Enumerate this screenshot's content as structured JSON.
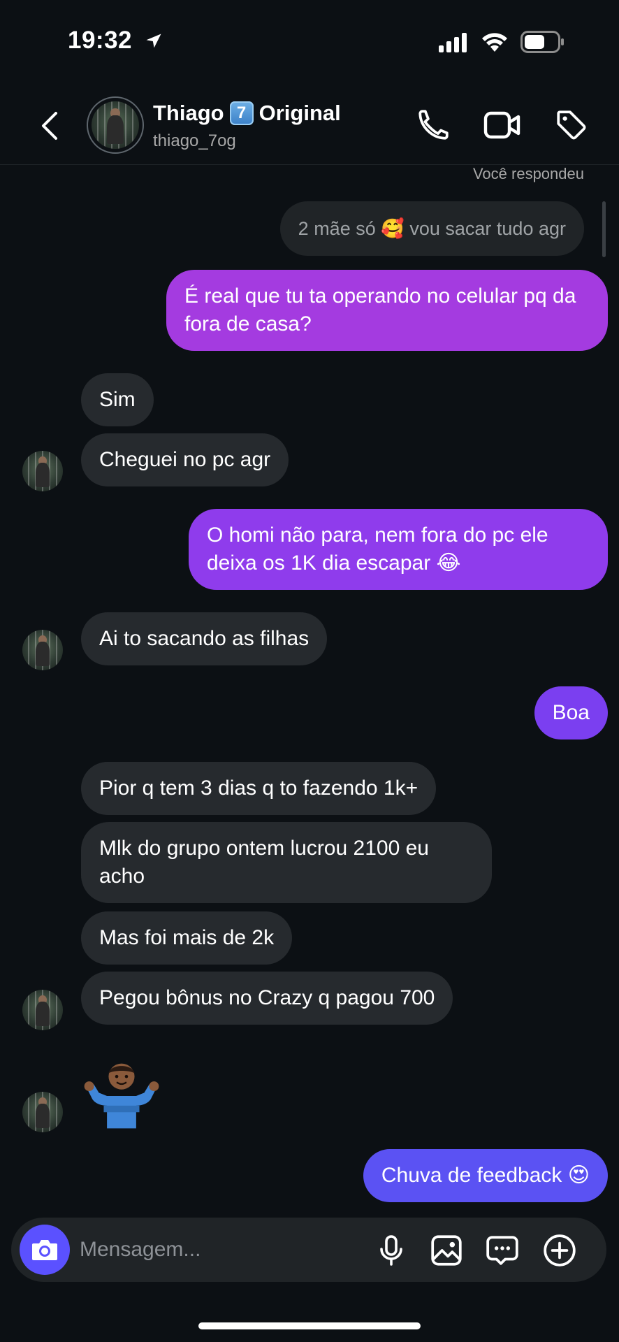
{
  "status_bar": {
    "time": "19:32"
  },
  "header": {
    "name": "Thiago",
    "badge": "7",
    "name_suffix": "Original",
    "username": "thiago_7og"
  },
  "reply": {
    "label": "Você respondeu",
    "quote": "2 mãe só 🥰 vou sacar tudo agr"
  },
  "messages": [
    {
      "side": "out",
      "text": "É real que tu ta operando no celular pq da fora de casa?"
    },
    {
      "side": "in",
      "text": "Sim"
    },
    {
      "side": "in",
      "text": "Cheguei no pc agr"
    },
    {
      "side": "out",
      "text": "O homi não para, nem fora do pc ele deixa os 1K dia escapar 😂"
    },
    {
      "side": "in",
      "text": "Ai to sacando as filhas"
    },
    {
      "side": "out",
      "text": "Boa"
    },
    {
      "side": "in",
      "text": "Pior q tem 3 dias q to fazendo 1k+"
    },
    {
      "side": "in",
      "text": "Mlk do grupo ontem lucrou 2100 eu acho"
    },
    {
      "side": "in",
      "text": "Mas foi mais de 2k"
    },
    {
      "side": "in",
      "text": "Pegou bônus no Crazy q pagou 700"
    },
    {
      "side": "in",
      "text": "🤷🏾‍♂️"
    },
    {
      "side": "out",
      "text": "Chuva de feedback 😍"
    }
  ],
  "composer": {
    "placeholder": "Mensagem..."
  },
  "colors": {
    "background": "#0c1014",
    "incoming_bubble": "#262a2e",
    "outgoing_purple": "#a43be0",
    "outgoing_violet": "#7b3ff0",
    "outgoing_blue": "#5b52f3",
    "accent": "#5b51ff"
  },
  "icons": {
    "status": [
      "location-arrow-icon",
      "signal-icon",
      "wifi-icon",
      "battery-icon"
    ],
    "header": [
      "back-icon",
      "call-icon",
      "video-icon",
      "tag-icon"
    ],
    "composer": [
      "camera-icon",
      "mic-icon",
      "gallery-icon",
      "sticker-icon",
      "plus-icon"
    ]
  }
}
